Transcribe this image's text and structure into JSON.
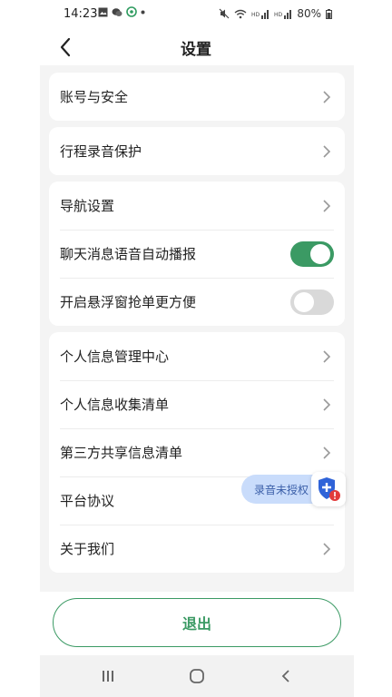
{
  "status_bar": {
    "time": "14:23",
    "battery": "80%",
    "icons": [
      "image-icon",
      "wechat-icon",
      "app-icon",
      "dot-icon",
      "mute-icon",
      "wifi-icon",
      "hd-signal-icon",
      "hd-signal-icon",
      "battery-icon"
    ]
  },
  "header": {
    "title": "设置",
    "back_icon": "chevron-left-icon"
  },
  "settings": {
    "group1": [
      {
        "label": "账号与安全",
        "control": "chevron"
      }
    ],
    "group2": [
      {
        "label": "行程录音保护",
        "control": "chevron"
      }
    ],
    "group3": [
      {
        "label": "导航设置",
        "control": "chevron"
      },
      {
        "label": "聊天消息语音自动播报",
        "control": "toggle",
        "state": "on"
      },
      {
        "label": "开启悬浮窗抢单更方便",
        "control": "toggle",
        "state": "off"
      }
    ],
    "group4": [
      {
        "label": "个人信息管理中心",
        "control": "chevron"
      },
      {
        "label": "个人信息收集清单",
        "control": "chevron"
      },
      {
        "label": "第三方共享信息清单",
        "control": "chevron"
      },
      {
        "label": "平台协议",
        "control": "none"
      },
      {
        "label": "关于我们",
        "control": "chevron"
      }
    ]
  },
  "floating": {
    "pill_text": "录音未授权",
    "shield_icon": "shield-alert-icon"
  },
  "logout": {
    "label": "退出"
  },
  "colors": {
    "accent": "#3b9a64",
    "toggle_off": "#d9d9d9",
    "page_bg": "#f4f4f4",
    "pill_bg": "#c9dcfb"
  }
}
